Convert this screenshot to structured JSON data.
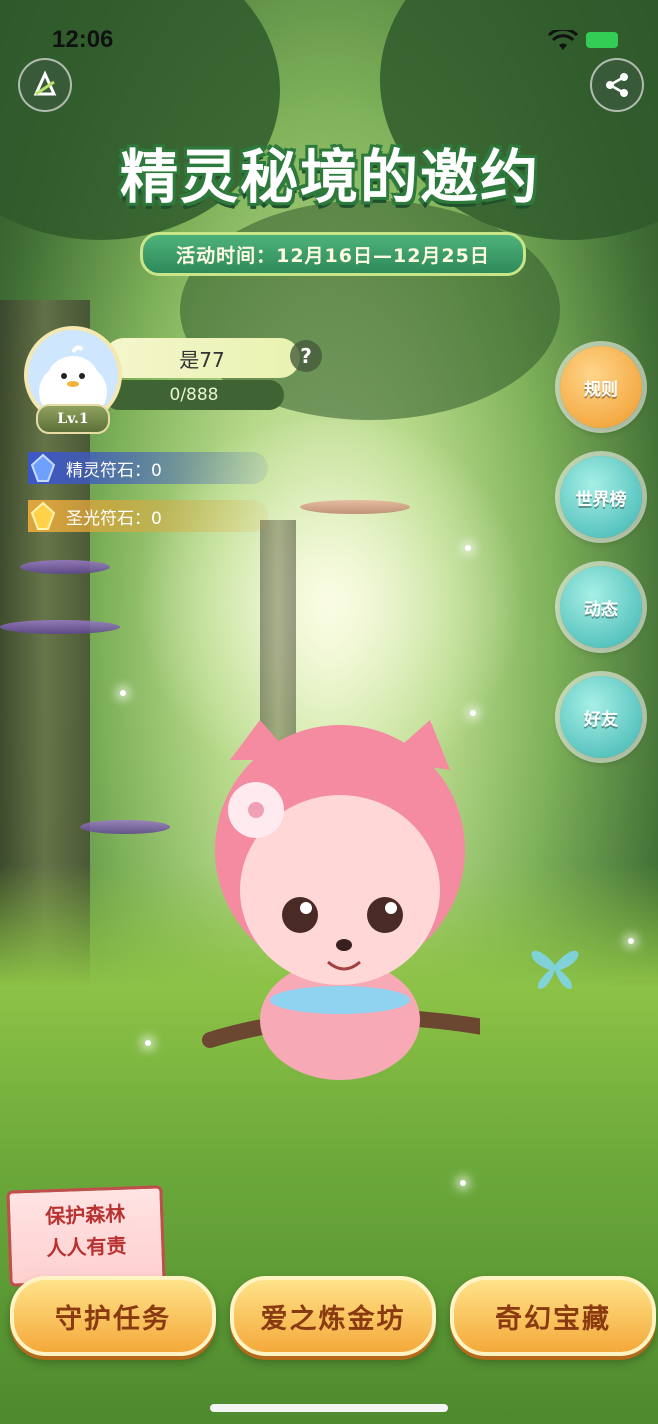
{
  "status_bar": {
    "time": "12:06",
    "wifi_icon": "wifi-icon",
    "battery_icon": "battery-charging-icon",
    "battery_color": "#33cc55"
  },
  "top_left_button": {
    "icon": "app-logo-icon"
  },
  "top_right_button": {
    "icon": "share-icon"
  },
  "header": {
    "title": "精灵秘境的邀约",
    "date_range": "活动时间：12月16日—12月25日"
  },
  "profile": {
    "name": "是77",
    "progress": "0/888",
    "level": "Lv.1",
    "help": "?"
  },
  "resources": [
    {
      "label": "精灵符石：0",
      "icon": "blue-crystal-icon",
      "color": "#3c58c8"
    },
    {
      "label": "圣光符石：0",
      "icon": "gold-crystal-icon",
      "color": "#e0a63c"
    }
  ],
  "side_menu": [
    {
      "label": "规则",
      "style": "orange"
    },
    {
      "label": "世界榜",
      "style": "teal"
    },
    {
      "label": "动态",
      "style": "teal"
    },
    {
      "label": "好友",
      "style": "teal"
    }
  ],
  "forest_badge": {
    "line1": "保护森林",
    "line2": "人人有责"
  },
  "bottom_actions": [
    {
      "label": "守护任务"
    },
    {
      "label": "爱之炼金坊"
    },
    {
      "label": "奇幻宝藏"
    }
  ]
}
